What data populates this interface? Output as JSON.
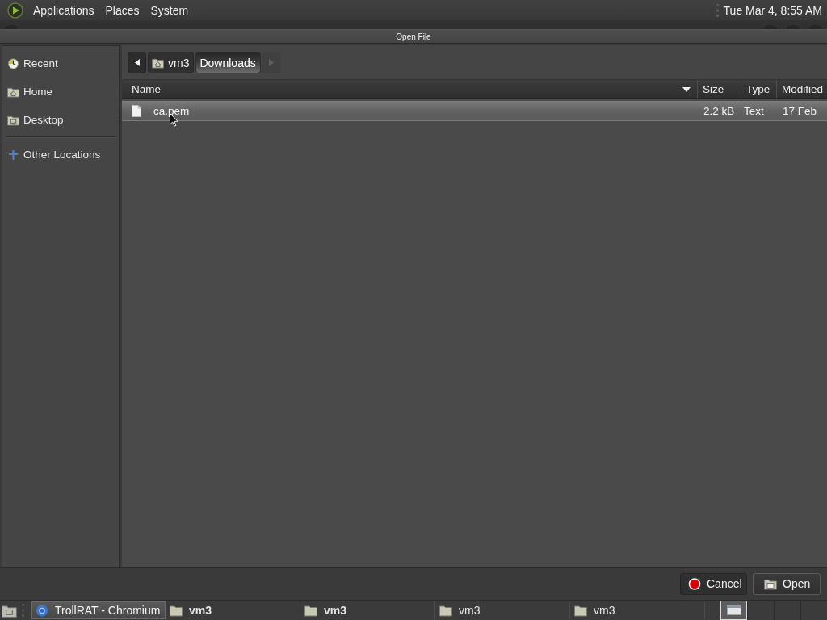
{
  "top_panel": {
    "menus": [
      "Applications",
      "Places",
      "System"
    ],
    "clock": "Tue Mar 4, 8:55 AM"
  },
  "dialog": {
    "title": "Open File",
    "sidebar": {
      "groups": [
        {
          "items": [
            {
              "label": "Recent",
              "kind": "recent",
              "selected": false
            },
            {
              "label": "Home",
              "kind": "home",
              "selected": false
            },
            {
              "label": "Desktop",
              "kind": "desktop",
              "selected": false
            }
          ]
        },
        {
          "items": [
            {
              "label": "Other Locations",
              "kind": "other",
              "selected": false
            }
          ]
        }
      ]
    },
    "path_bar": {
      "back": {
        "disabled": false
      },
      "crumbs": [
        {
          "label": "vm3",
          "kind": "home",
          "selected": false
        },
        {
          "label": "Downloads",
          "kind": "folder",
          "selected": true
        }
      ],
      "forward": {
        "disabled": true
      }
    },
    "table": {
      "columns": [
        {
          "label": "Name",
          "sorted": true
        },
        {
          "label": "Size",
          "sorted": false
        },
        {
          "label": "Type",
          "sorted": false
        },
        {
          "label": "Modified",
          "sorted": false
        }
      ],
      "rows": [
        {
          "name": "ca.pem",
          "size": "2.2 kB",
          "type": "Text",
          "modified": "17 Feb",
          "selected": true
        }
      ]
    },
    "buttons": [
      {
        "label": "Cancel",
        "kind": "cancel"
      },
      {
        "label": "Open",
        "kind": "open"
      }
    ]
  },
  "taskbar": {
    "tasks": [
      {
        "label": "TrollRAT - Chromium",
        "kind": "browser",
        "active": true,
        "bold": false
      },
      {
        "label": "vm3",
        "kind": "folder",
        "active": false,
        "bold": true
      },
      {
        "label": "vm3",
        "kind": "folder",
        "active": false,
        "bold": true
      },
      {
        "label": "vm3",
        "kind": "folder",
        "active": false,
        "bold": false
      },
      {
        "label": "vm3",
        "kind": "folder",
        "active": false,
        "bold": false
      }
    ],
    "workspaces": [
      {
        "selected": true
      },
      {
        "selected": false
      },
      {
        "selected": false
      },
      {
        "selected": false
      }
    ]
  }
}
